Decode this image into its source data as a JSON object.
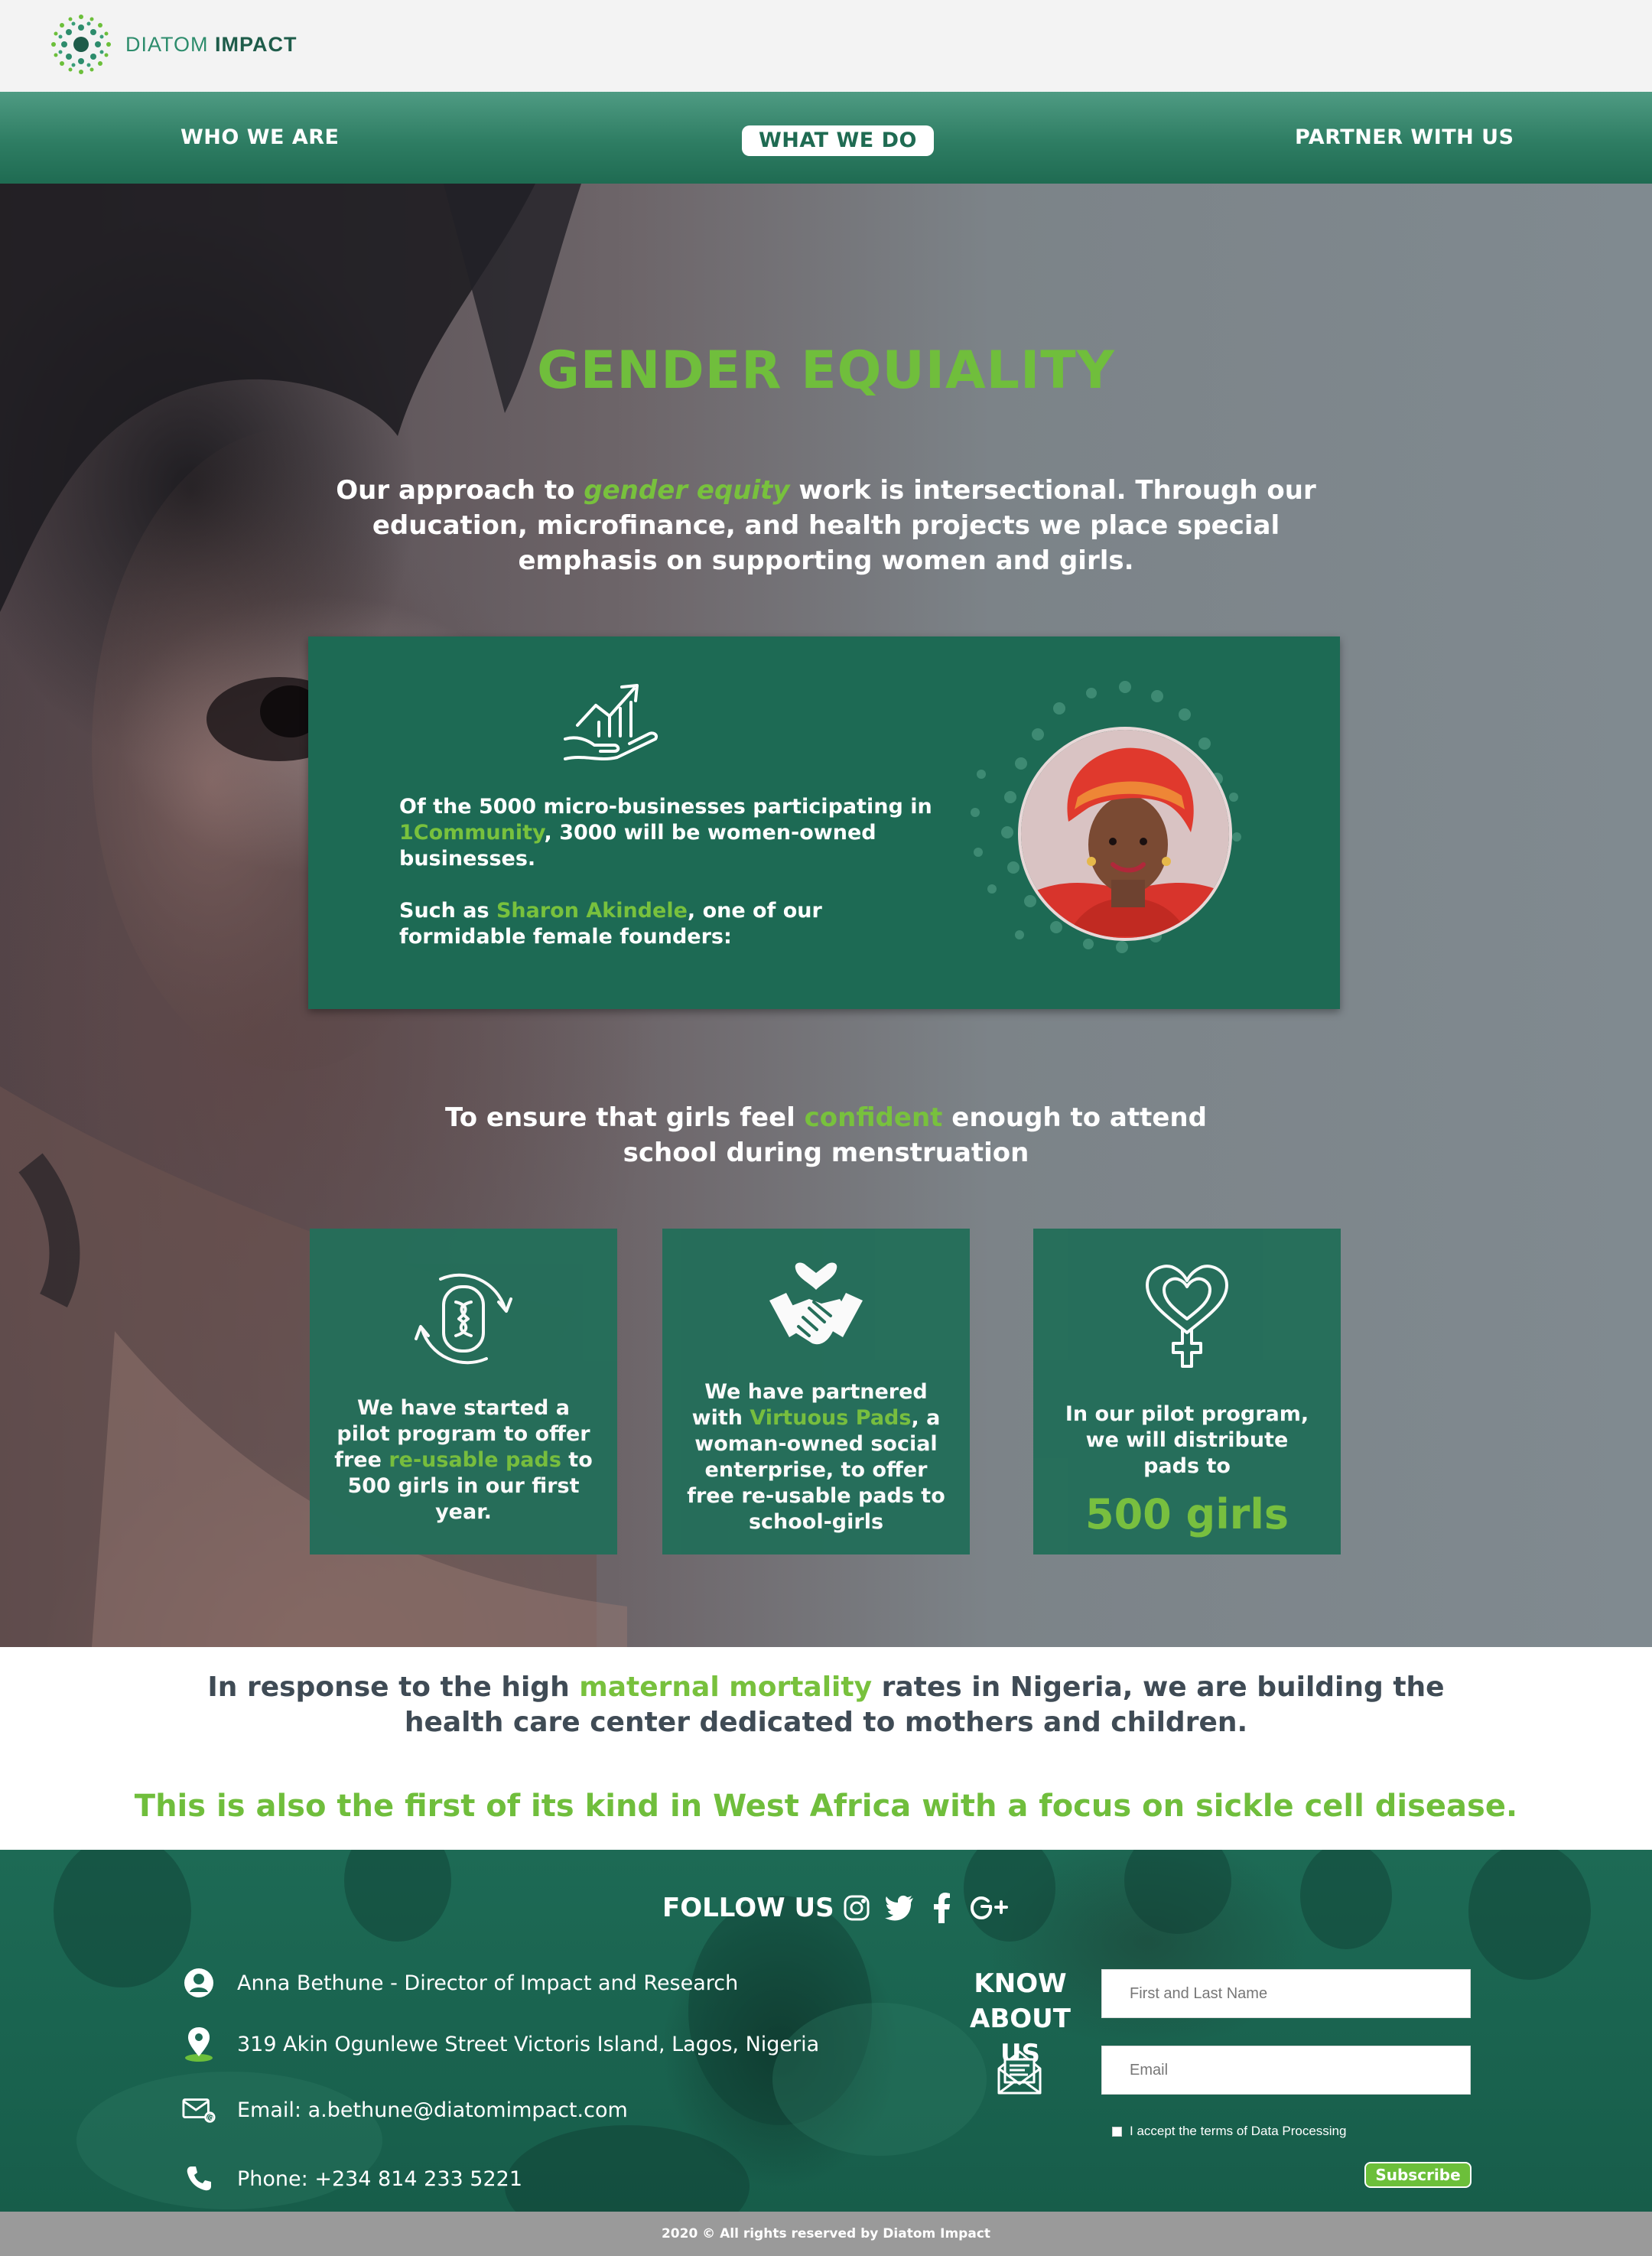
{
  "brand": {
    "name_light": "DIATOM ",
    "name_bold": "IMPACT"
  },
  "nav": {
    "who_we_are": "WHO WE ARE",
    "what_we_do": "WHAT WE DO",
    "partner_with_us": "PARTNER WITH US"
  },
  "hero": {
    "title": "GENDER EQUIALITY",
    "intro_before": "Our approach to ",
    "intro_highlight": "gender equity",
    "intro_after": " work is intersectional. Through our education, microfinance, and health projects we place special emphasis on supporting women and girls."
  },
  "feature": {
    "p1_before": "Of the 5000 micro-businesses participating in ",
    "p1_highlight": "1Community",
    "p1_after": ", 3000 will be women-owned businesses.",
    "p2_before": "Such as  ",
    "p2_highlight": "Sharon Akindele",
    "p2_after": ", one of our formidable female founders:"
  },
  "subhead": {
    "before": "To ensure that girls feel ",
    "highlight": "confident",
    "after": " enough to attend school during menstruation"
  },
  "tiles": [
    {
      "before": "We have started a pilot program to offer free ",
      "highlight": "re-usable pads",
      "after": " to 500 girls in our first year."
    },
    {
      "before": "We have partnered with ",
      "highlight": "Virtuous Pads",
      "after": ", a woman-owned social enterprise, to offer free re-usable pads to school-girls"
    },
    {
      "text": "In our pilot program, we will distribute pads to",
      "stat": "500 girls"
    }
  ],
  "statement": {
    "before": "In response to the high ",
    "highlight": "maternal mortality",
    "after": " rates in Nigeria, we are building the health care center dedicated to mothers and children.",
    "sub": "This is also the first of its kind in West Africa with a focus on sickle cell disease."
  },
  "footer": {
    "follow_us": "FOLLOW US",
    "social_icons": [
      "instagram-icon",
      "twitter-icon",
      "facebook-icon",
      "google-plus-icon"
    ],
    "contact_name": "Anna Bethune - Director of Impact and Research",
    "contact_address": "319 Akin Ogunlewe Street Victoris Island, Lagos, Nigeria",
    "contact_email": "Email: a.bethune@diatomimpact.com",
    "contact_phone": "Phone: +234 814 233 5221",
    "know_about_us": "KNOW ABOUT US",
    "name_placeholder": "First and  Last Name",
    "email_placeholder": "Email",
    "consent_label": "I accept the terms of Data Processing",
    "subscribe_label": "Subscribe"
  },
  "copyright": "2020 © All rights reserved by Diatom Impact",
  "colors": {
    "accent_green": "#78c13d",
    "brand_teal": "#1d6a54",
    "nav_teal": "#2e7d63"
  }
}
